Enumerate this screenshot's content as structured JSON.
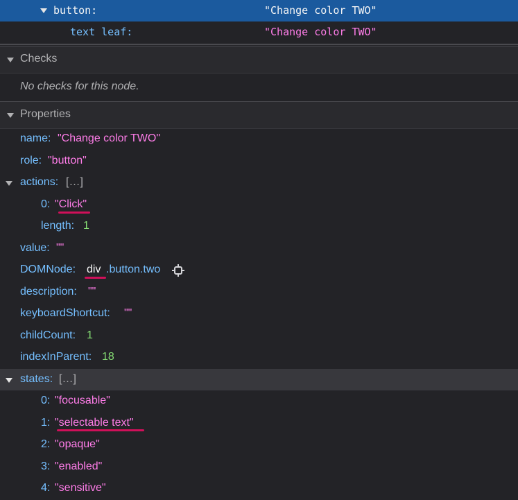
{
  "tree": {
    "button_key": "button:",
    "button_value": "\"Change color TWO\"",
    "text_leaf_key": "text leaf:",
    "text_leaf_value": "\"Change color TWO\""
  },
  "checks": {
    "title": "Checks",
    "empty_text": "No checks for this node."
  },
  "properties": {
    "title": "Properties",
    "name_key": "name:",
    "name_value": "\"Change color TWO\"",
    "role_key": "role:",
    "role_value": "\"button\"",
    "actions_key": "actions:",
    "actions_value": "[…]",
    "action_0_key": "0:",
    "action_0_value": "\"Click\"",
    "length_key": "length:",
    "length_value": "1",
    "value_key": "value:",
    "value_value": "\"\"",
    "domnode_key": "DOMNode:",
    "domnode_tag": "div",
    "domnode_rest": ".button.two",
    "description_key": "description:",
    "description_value": "\"\"",
    "shortcut_key": "keyboardShortcut:",
    "shortcut_value": "\"\"",
    "childcount_key": "childCount:",
    "childcount_value": "1",
    "index_key": "indexInParent:",
    "index_value": "18"
  },
  "states": {
    "key": "states:",
    "value": "[…]",
    "items": [
      {
        "key": "0:",
        "value": "\"focusable\""
      },
      {
        "key": "1:",
        "value": "\"selectable text\""
      },
      {
        "key": "2:",
        "value": "\"opaque\""
      },
      {
        "key": "3:",
        "value": "\"enabled\""
      },
      {
        "key": "4:",
        "value": "\"sensitive\""
      }
    ]
  },
  "colors": {
    "selection": "#1b5a9e",
    "string": "#ff7de9",
    "key": "#75bfff",
    "number": "#86de74",
    "highlight_underline": "#d0105a"
  },
  "icons": {
    "expand": "triangle-down-icon",
    "select_node": "crosshair-icon"
  }
}
